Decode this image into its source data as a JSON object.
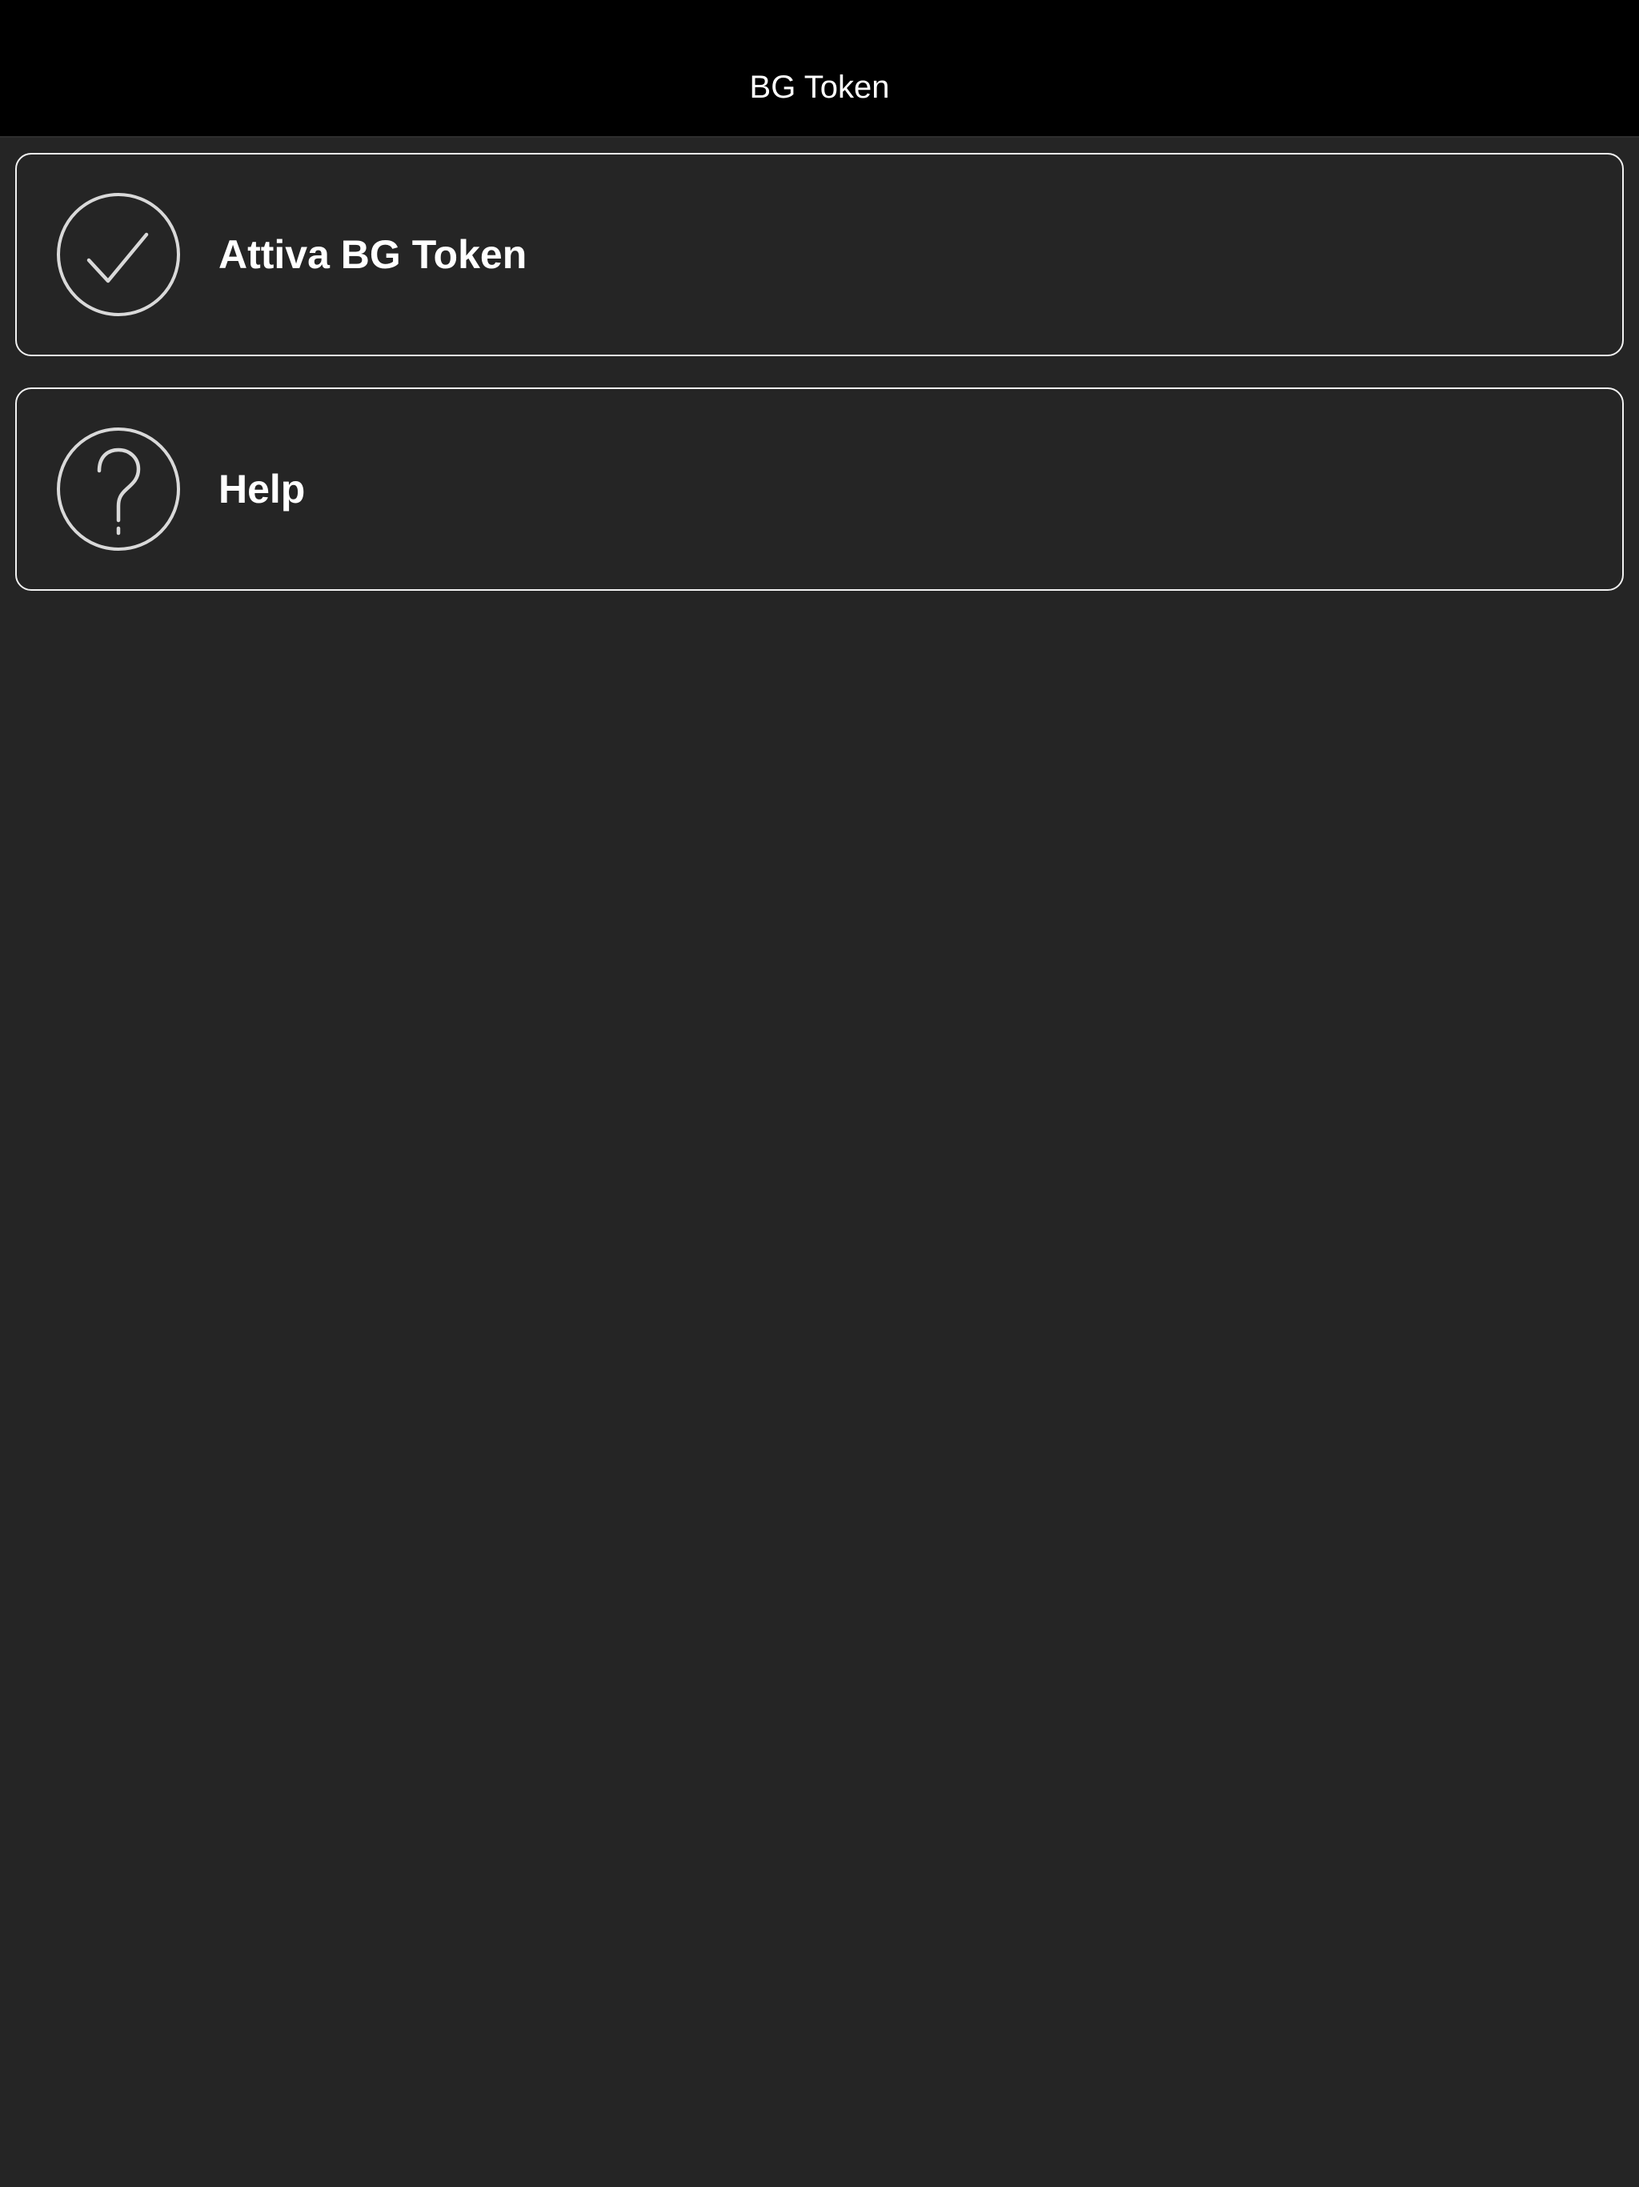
{
  "header": {
    "title": "BG Token"
  },
  "menu": {
    "items": [
      {
        "label": "Attiva BG Token",
        "icon": "check-circle-icon"
      },
      {
        "label": "Help",
        "icon": "question-circle-icon"
      }
    ]
  },
  "colors": {
    "background": "#252525",
    "header_background": "#000000",
    "text": "#ffffff",
    "card_border": "#f2f2f2",
    "icon_stroke": "#d9d9d9"
  }
}
